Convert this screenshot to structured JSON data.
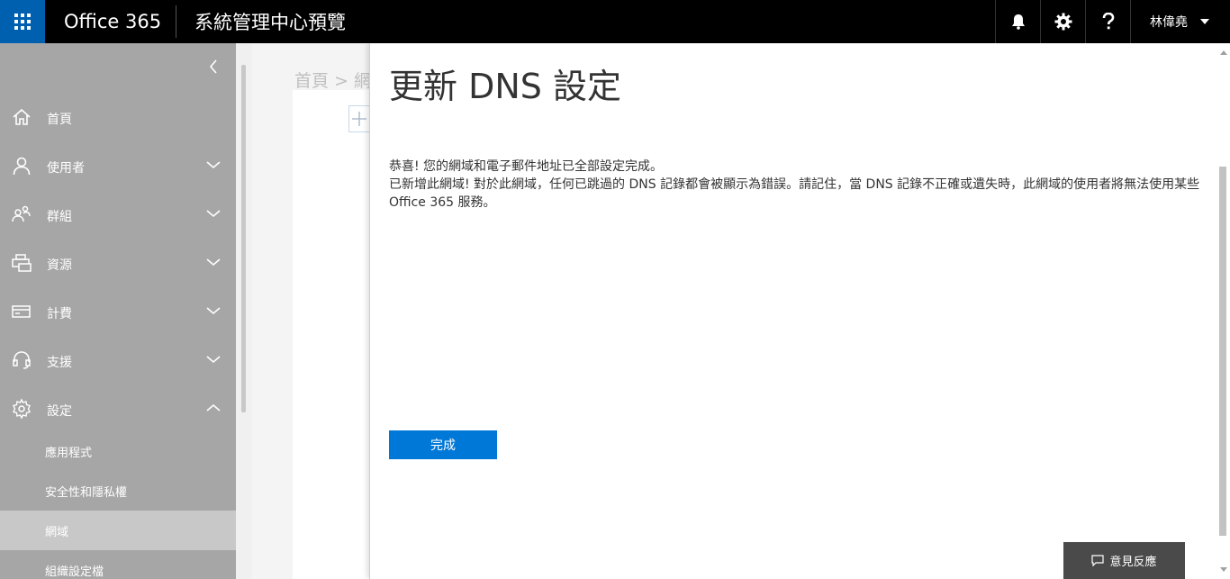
{
  "topbar": {
    "brand": "Office 365",
    "app_title": "系統管理中心預覽",
    "user_name": "林偉堯",
    "icons": [
      "app-launcher-icon",
      "bell-icon",
      "gear-icon",
      "help-icon"
    ]
  },
  "sidebar": {
    "items": [
      {
        "label": "首頁",
        "icon": "home-icon"
      },
      {
        "label": "使用者",
        "icon": "user-icon"
      },
      {
        "label": "群組",
        "icon": "group-icon"
      },
      {
        "label": "資源",
        "icon": "printer-icon"
      },
      {
        "label": "計費",
        "icon": "card-icon"
      },
      {
        "label": "支援",
        "icon": "headset-icon"
      },
      {
        "label": "設定",
        "icon": "gear-icon"
      }
    ],
    "settings_sub": [
      {
        "label": "應用程式"
      },
      {
        "label": "安全性和隱私權"
      },
      {
        "label": "網域",
        "active": true
      },
      {
        "label": "組織設定檔"
      }
    ]
  },
  "background": {
    "breadcrumb": "首頁 > 網域"
  },
  "panel": {
    "title": "更新 DNS 設定",
    "line1": "恭喜! 您的網域和電子郵件地址已全部設定完成。",
    "line2": "已新增此網域! 對於此網域，任何已跳過的 DNS 記錄都會被顯示為錯誤。請記住，當 DNS 記錄不正確或遺失時，此網域的使用者將無法使用某些 Office 365 服務。",
    "done_label": "完成"
  },
  "feedback": {
    "label": "意見反應"
  },
  "colors": {
    "accent": "#0078d7",
    "waffle": "#0060b0",
    "sidebar": "#a6a6a6",
    "topbar": "#000000"
  }
}
